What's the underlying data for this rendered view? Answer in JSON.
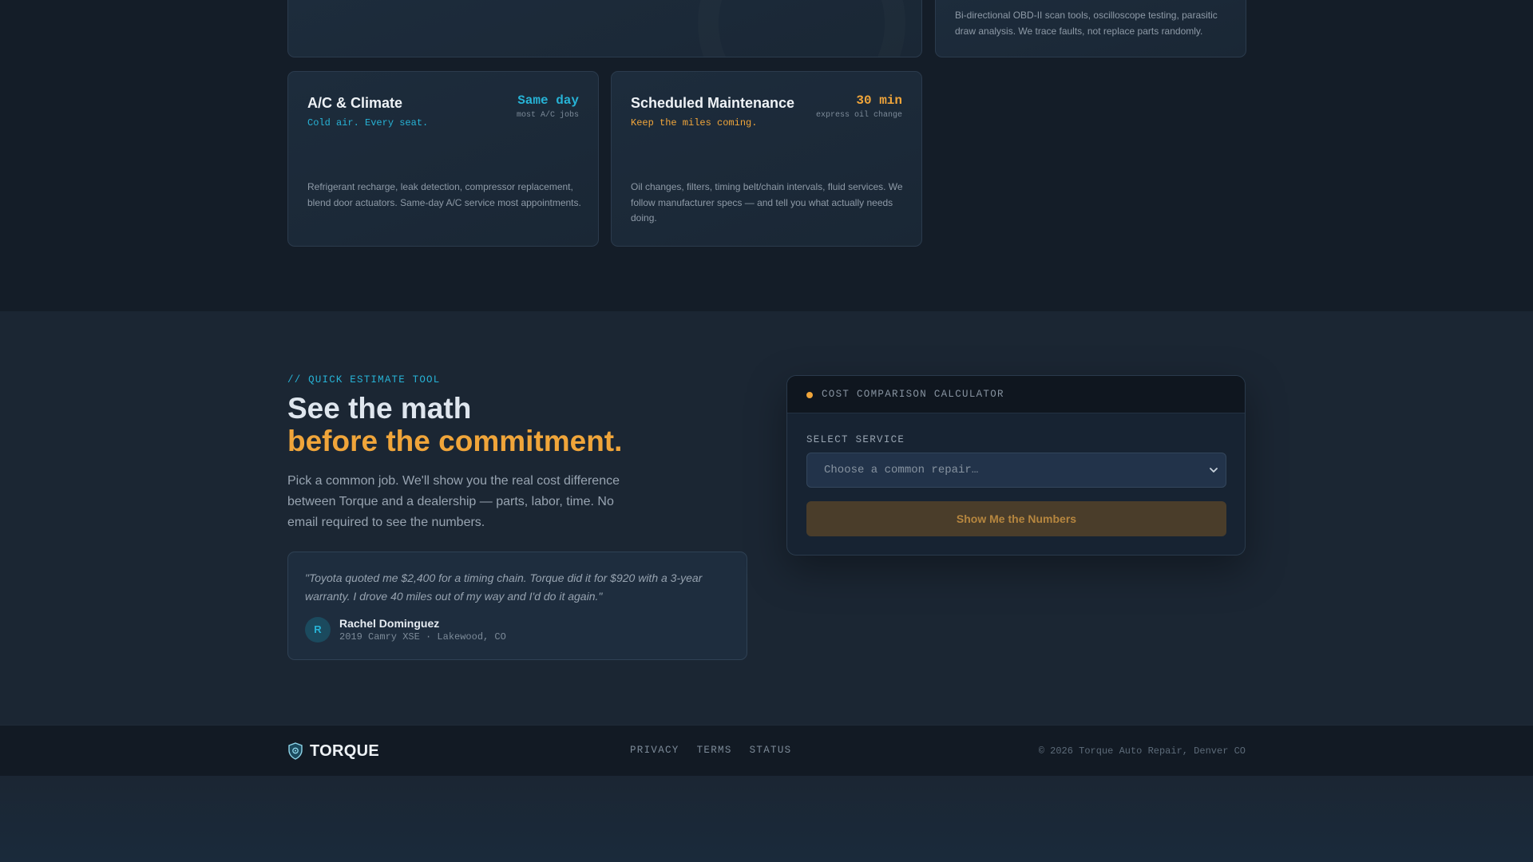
{
  "services": {
    "top_right_desc": "Bi-directional OBD-II scan tools, oscilloscope testing, parasitic draw analysis. We trace faults, not replace parts randomly.",
    "cards": [
      {
        "title": "A/C & Climate",
        "tagline": "Cold air. Every seat.",
        "metric_value": "Same day",
        "metric_caption": "most A/C jobs",
        "description": "Refrigerant recharge, leak detection, compressor replacement, blend door actuators. Same-day A/C service most appointments."
      },
      {
        "title": "Scheduled Maintenance",
        "tagline": "Keep the miles coming.",
        "metric_value": "30 min",
        "metric_caption": "express oil change",
        "description": "Oil changes, filters, timing belt/chain intervals, fluid services. We follow manufacturer specs — and tell you what actually needs doing."
      }
    ]
  },
  "estimate": {
    "eyebrow": "// QUICK ESTIMATE TOOL",
    "headline_line1": "See the math",
    "headline_line2": "before the commitment.",
    "lead": "Pick a common job. We'll show you the real cost difference between Torque and a dealership — parts, labor, time. No email required to see the numbers.",
    "testimonial": {
      "quote": "\"Toyota quoted me $2,400 for a timing chain. Torque did it for $920 with a 3-year warranty. I drove 40 miles out of my way and I'd do it again.\"",
      "avatar_initial": "R",
      "author": "Rachel Dominguez",
      "meta": "2019 Camry XSE · Lakewood, CO"
    }
  },
  "calculator": {
    "title": "COST COMPARISON CALCULATOR",
    "field_label": "SELECT SERVICE",
    "select_placeholder": "Choose a common repair…",
    "button_label": "Show Me the Numbers"
  },
  "footer": {
    "brand": "TORQUE",
    "links": [
      "PRIVACY",
      "TERMS",
      "STATUS"
    ],
    "copyright": "© 2026 Torque Auto Repair, Denver CO"
  },
  "colors": {
    "accent_cyan": "#27b3d6",
    "accent_amber": "#f0a53a",
    "background": "#1b2633"
  }
}
